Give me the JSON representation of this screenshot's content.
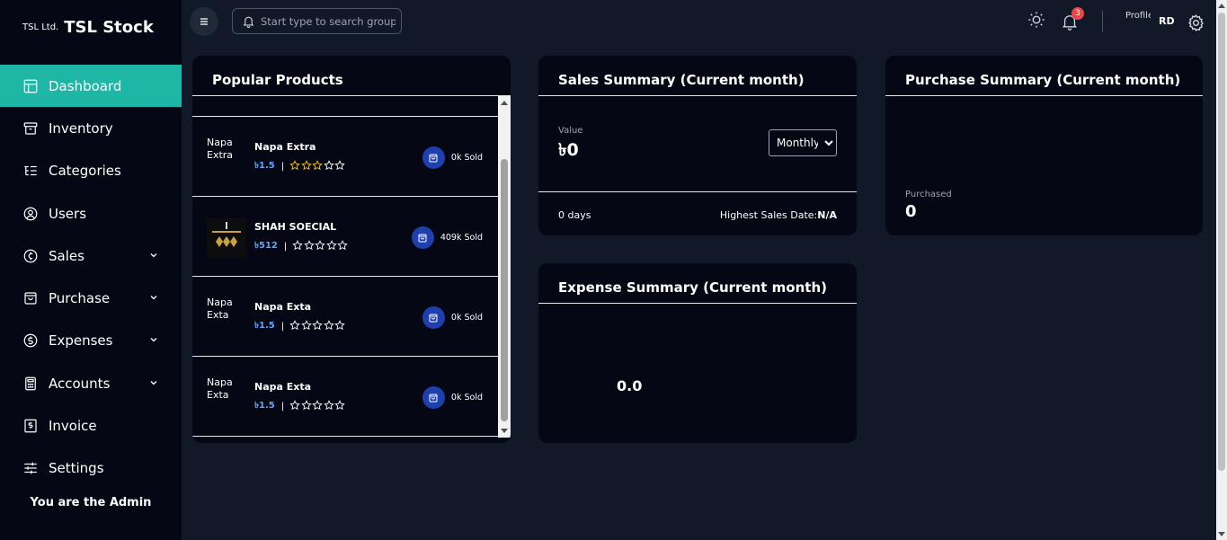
{
  "brand": {
    "company": "TSL Ltd.",
    "name": "TSL Stock"
  },
  "sidebar": {
    "items": [
      {
        "label": "Dashboard",
        "icon": "dashboard-icon",
        "active": true
      },
      {
        "label": "Inventory",
        "icon": "archive-icon"
      },
      {
        "label": "Categories",
        "icon": "list-icon"
      },
      {
        "label": "Users",
        "icon": "user-circle-icon"
      },
      {
        "label": "Sales",
        "icon": "currency-circle-icon",
        "has_children": true
      },
      {
        "label": "Purchase",
        "icon": "shopping-bag-icon",
        "has_children": true
      },
      {
        "label": "Expenses",
        "icon": "dollar-circle-icon",
        "has_children": true
      },
      {
        "label": "Accounts",
        "icon": "calculator-icon",
        "has_children": true
      },
      {
        "label": "Invoice",
        "icon": "invoice-icon"
      },
      {
        "label": "Settings",
        "icon": "sliders-icon"
      }
    ],
    "footer": "You are the Admin"
  },
  "topbar": {
    "search_placeholder": "Start type to search groups",
    "notification_count": "3",
    "avatar_alt": "Profile",
    "initials": "RD",
    "icons": [
      "menu-icon",
      "bell-icon",
      "sun-icon",
      "bell-icon",
      "gear-icon"
    ]
  },
  "popular": {
    "title": "Popular Products",
    "products": [
      {
        "name": "Napa Extra",
        "price": "৳1.5",
        "rating": 3,
        "sold": "0k Sold",
        "image_alt": "Napa Extra",
        "has_image": false
      },
      {
        "name": "SHAH SOECIAL",
        "price": "৳512",
        "rating": 0,
        "sold": "409k Sold",
        "image_alt": "",
        "has_image": true
      },
      {
        "name": "Napa Exta",
        "price": "৳1.5",
        "rating": 0,
        "sold": "0k Sold",
        "image_alt": "Napa Exta",
        "has_image": false
      },
      {
        "name": "Napa Exta",
        "price": "৳1.5",
        "rating": 0,
        "sold": "0k Sold",
        "image_alt": "Napa Exta",
        "has_image": false
      }
    ]
  },
  "sales_summary": {
    "title": "Sales Summary (Current month)",
    "value_label": "Value",
    "value": "৳0",
    "period_options": [
      "Monthly"
    ],
    "period_selected": "Monthly",
    "days": "0 days",
    "highest_label": "Highest Sales Date:",
    "highest_value": "N/A"
  },
  "purchase_summary": {
    "title": "Purchase Summary (Current month)",
    "purchased_label": "Purchased",
    "purchased_value": "0"
  },
  "expense_summary": {
    "title": "Expense Summary (Current month)",
    "value": "0.0"
  },
  "colors": {
    "accent": "#1eb7a6",
    "sidebar_bg": "#050814",
    "page_bg": "#111827",
    "card_bg": "#050814",
    "star": "#facc15",
    "price": "#60a5fa",
    "badge": "#ef4444"
  }
}
